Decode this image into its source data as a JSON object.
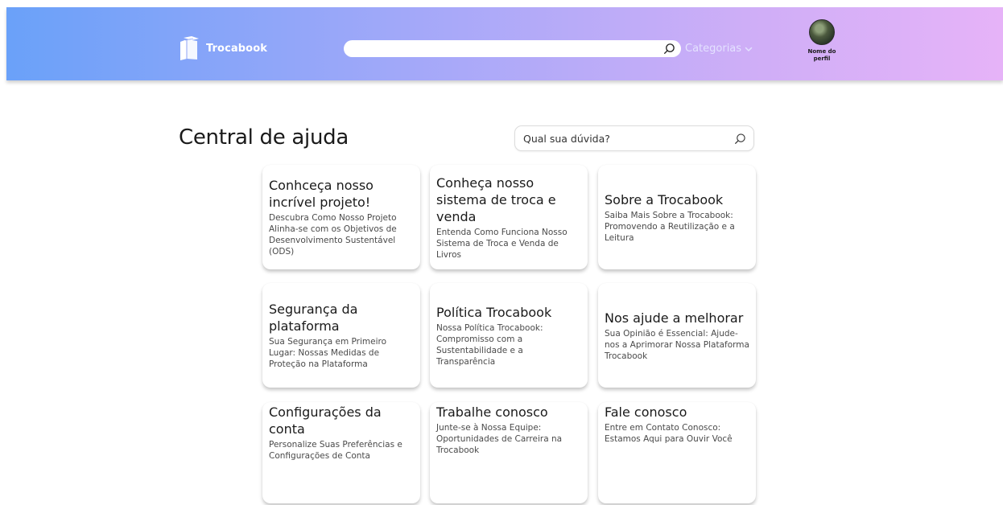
{
  "header": {
    "logo_text": "Trocabook",
    "search": {
      "value": ""
    },
    "categories_label": "Categorias",
    "profile_name": "Nome do perfil"
  },
  "main": {
    "title": "Central de ajuda",
    "help_search_placeholder": "Qual sua dúvida?",
    "cards": [
      {
        "title": "Conhceça nosso incrível projeto!",
        "desc": "Descubra Como Nosso Projeto Alinha-se com os Objetivos de Desenvolvimento Sustentável (ODS)"
      },
      {
        "title": "Conheça nosso sistema de troca e venda",
        "desc": "Entenda Como Funciona Nosso Sistema de Troca e Venda de Livros"
      },
      {
        "title": "Sobre a Trocabook",
        "desc": "Saiba Mais Sobre a Trocabook: Promovendo a Reutilização e a Leitura"
      },
      {
        "title": "Segurança da plataforma",
        "desc": "Sua Segurança em Primeiro Lugar: Nossas Medidas de Proteção na Plataforma"
      },
      {
        "title": "Política Trocabook",
        "desc": "Nossa Política Trocabook: Compromisso com a Sustentabilidade e a Transparência"
      },
      {
        "title": "Nos ajude a melhorar",
        "desc": "Sua Opinião é Essencial: Ajude-nos a Aprimorar Nossa Plataforma Trocabook"
      },
      {
        "title": "Configurações da conta",
        "desc": "Personalize Suas Preferências e Configurações de Conta"
      },
      {
        "title": "Trabalhe conosco",
        "desc": "Junte-se à Nossa Equipe: Oportunidades de Carreira na Trocabook"
      },
      {
        "title": "Fale conosco",
        "desc": "Entre em Contato Conosco: Estamos Aqui para Ouvir Você"
      }
    ]
  },
  "colors": {
    "header_gradient_start": "#6aa1f9",
    "header_gradient_end": "#e6b3f8",
    "categories_text": "#e4e2ff"
  },
  "icons": {
    "logo": "books-icon",
    "search": "search-icon",
    "categories": "chevron-down-icon"
  }
}
